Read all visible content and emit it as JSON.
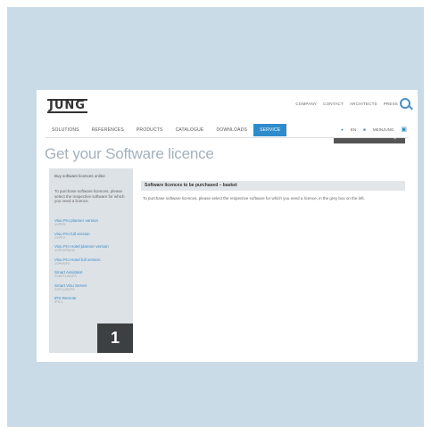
{
  "header": {
    "logo": "JUNG",
    "top_links": [
      "COMPANY",
      "CONTACT",
      "ARCHITECTS",
      "PRESS"
    ]
  },
  "main_nav": {
    "items": [
      "SOLUTIONS",
      "REFERENCES",
      "PRODUCTS",
      "CATALOGUE",
      "DOWNLOADS",
      "SERVICE"
    ],
    "active": "SERVICE",
    "language": "EN",
    "account": "MEINJUNG"
  },
  "page_title": "Get your Software licence",
  "sidebar": {
    "heading": "Buy software licences online",
    "description": "To purchase software licences, please select the respective software for which you need a licence.",
    "links": [
      {
        "name": "Visu Pro planner version",
        "code": "1VPPR"
      },
      {
        "name": "Visu Pro full version",
        "code": "1VPFV"
      },
      {
        "name": "Visu Pro Hotel planner version",
        "code": "1VPHVPALW"
      },
      {
        "name": "Visu Pro Hotel full version",
        "code": "1VPHVFV"
      },
      {
        "name": "Smart Assistant",
        "code": "SVAPLUSDFS"
      },
      {
        "name": "Smart Visu Server",
        "code": "SVPLUSDFS"
      },
      {
        "name": "IPS-Remote",
        "code": "IPS-1"
      }
    ]
  },
  "badge": "1",
  "content": {
    "section_title": "Software licences to be purchased – basket",
    "instructions": "To purchase software licences, please select the respective software for which you need a licence, in the grey box on the left."
  }
}
